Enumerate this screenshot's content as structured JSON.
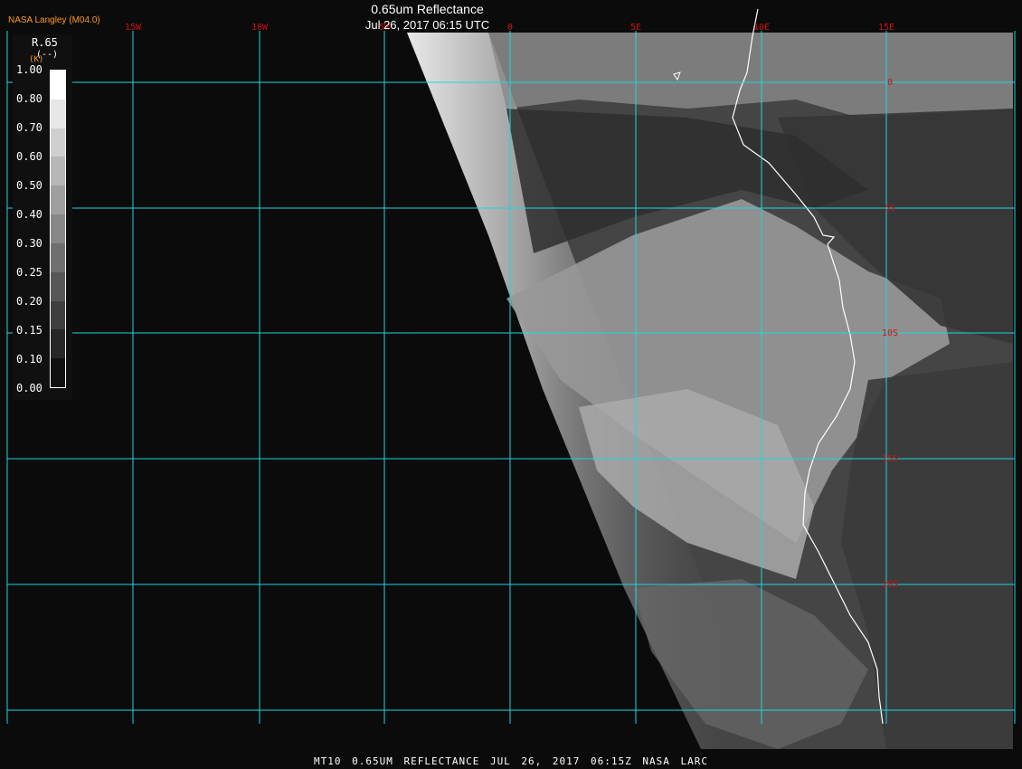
{
  "header": {
    "title": "0.65um Reflectance",
    "subtitle": "Jul 26, 2017 06:15 UTC",
    "source": "NASA Langley (M04.0)"
  },
  "legend": {
    "variable": "R.65",
    "units": "(--)",
    "units_prefix": "(K)",
    "ticks": [
      "1.00",
      "0.80",
      "0.70",
      "0.60",
      "0.50",
      "0.40",
      "0.30",
      "0.25",
      "0.20",
      "0.15",
      "0.10",
      "0.00"
    ]
  },
  "grid": {
    "longitude_labels": [
      "15W",
      "10W",
      "5W",
      "0",
      "5E",
      "10E",
      "15E"
    ],
    "latitude_labels": [
      "0",
      "5S",
      "10S",
      "15S",
      "20S"
    ]
  },
  "footer": "MT10  0.65UM REFLECTANCE   JUL 26, 2017 06:15Z   NASA LARC",
  "colors": {
    "grid": "#1ed6e0",
    "geo_label": "#d01010",
    "source_label": "#ff9a1a",
    "coastline": "#ffffff",
    "background": "#000000"
  }
}
